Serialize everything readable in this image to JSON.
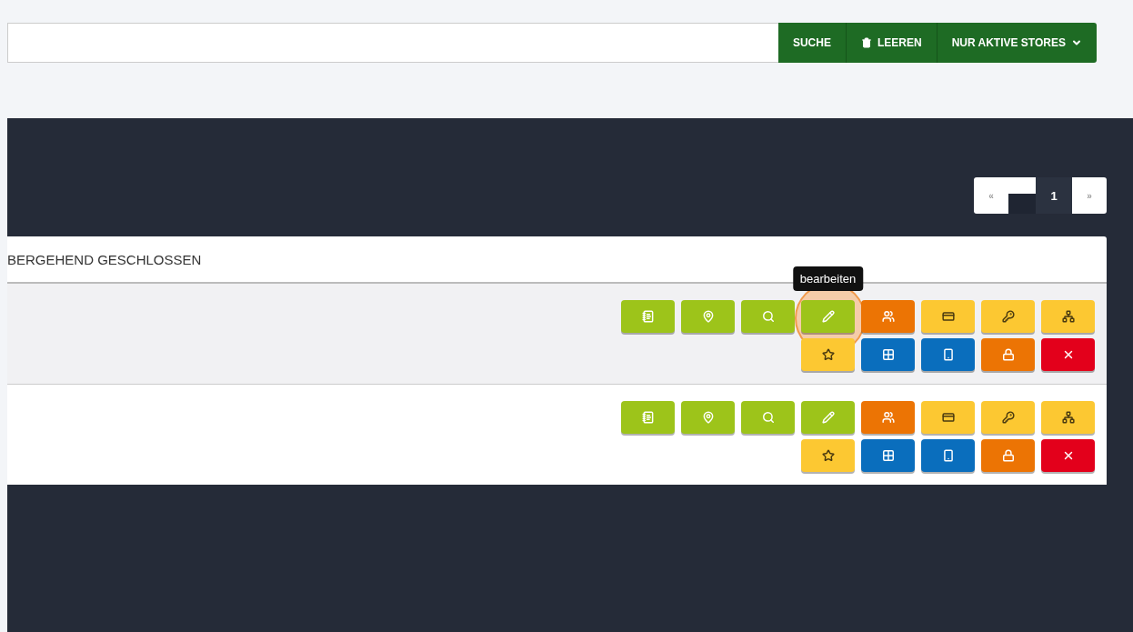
{
  "search": {
    "buttons": [
      {
        "kind": "search",
        "label": "SUCHE"
      },
      {
        "kind": "clear",
        "label": "LEEREN"
      },
      {
        "kind": "dropdown",
        "label": "NUR AKTIVE STORES"
      }
    ]
  },
  "pagination": [
    {
      "kind": "prev",
      "label": "«",
      "selected": false
    },
    {
      "kind": "blank"
    },
    {
      "kind": "page",
      "label": "1",
      "selected": true
    },
    {
      "kind": "next",
      "label": "»",
      "selected": false
    }
  ],
  "table": {
    "header": "BERGEHEND GESCHLOSSEN",
    "rows": [
      {
        "highlighted": true,
        "actions": [
          {
            "kind": "notes",
            "color": "#9dc41a"
          },
          {
            "kind": "location",
            "color": "#9dc41a"
          },
          {
            "kind": "search",
            "color": "#9dc41a"
          },
          {
            "kind": "edit",
            "color": "#9dc41a",
            "hovered": true,
            "tooltip": "bearbeiten"
          },
          {
            "kind": "users",
            "color": "#ec7404"
          },
          {
            "kind": "card",
            "color": "#fcc832"
          },
          {
            "kind": "key",
            "color": "#fcc832"
          },
          {
            "kind": "tree",
            "color": "#fcc832"
          },
          {
            "kind": "star",
            "color": "#fcc832"
          },
          {
            "kind": "grid",
            "color": "#0a6ebd"
          },
          {
            "kind": "phone",
            "color": "#0a6ebd"
          },
          {
            "kind": "lock",
            "color": "#ec7404"
          },
          {
            "kind": "delete",
            "color": "#e3001b"
          }
        ]
      },
      {
        "highlighted": false,
        "actions": [
          {
            "kind": "notes",
            "color": "#9dc41a"
          },
          {
            "kind": "location",
            "color": "#9dc41a"
          },
          {
            "kind": "search",
            "color": "#9dc41a"
          },
          {
            "kind": "edit",
            "color": "#9dc41a",
            "hovered": false
          },
          {
            "kind": "users",
            "color": "#ec7404"
          },
          {
            "kind": "card",
            "color": "#fcc832"
          },
          {
            "kind": "key",
            "color": "#fcc832"
          },
          {
            "kind": "tree",
            "color": "#fcc832"
          },
          {
            "kind": "star",
            "color": "#fcc832"
          },
          {
            "kind": "grid",
            "color": "#0a6ebd"
          },
          {
            "kind": "phone",
            "color": "#0a6ebd"
          },
          {
            "kind": "lock",
            "color": "#ec7404"
          },
          {
            "kind": "delete",
            "color": "#e3001b"
          }
        ]
      }
    ]
  }
}
